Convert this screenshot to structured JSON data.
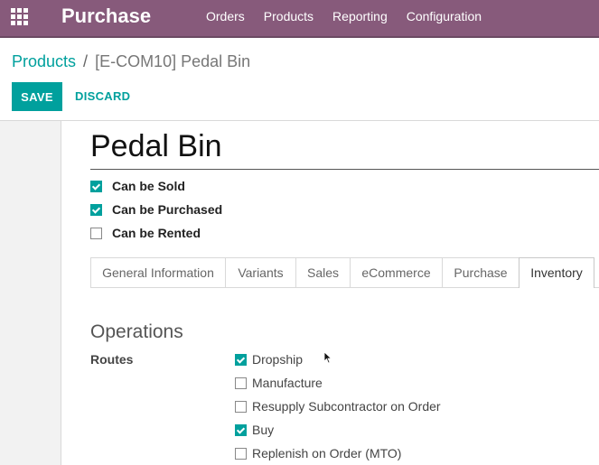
{
  "navbar": {
    "app_name": "Purchase",
    "menu": [
      "Orders",
      "Products",
      "Reporting",
      "Configuration"
    ]
  },
  "breadcrumb": {
    "parent": "Products",
    "separator": "/",
    "current": "[E-COM10] Pedal Bin"
  },
  "actions": {
    "save": "SAVE",
    "discard": "DISCARD"
  },
  "product": {
    "name": "Pedal Bin",
    "options": [
      {
        "label": "Can be Sold",
        "checked": true
      },
      {
        "label": "Can be Purchased",
        "checked": true
      },
      {
        "label": "Can be Rented",
        "checked": false
      }
    ]
  },
  "tabs": [
    {
      "label": "General Information",
      "active": false
    },
    {
      "label": "Variants",
      "active": false
    },
    {
      "label": "Sales",
      "active": false
    },
    {
      "label": "eCommerce",
      "active": false
    },
    {
      "label": "Purchase",
      "active": false
    },
    {
      "label": "Inventory",
      "active": true
    }
  ],
  "operations": {
    "title": "Operations",
    "routes_label": "Routes",
    "routes": [
      {
        "label": "Dropship",
        "checked": true
      },
      {
        "label": "Manufacture",
        "checked": false
      },
      {
        "label": "Resupply Subcontractor on Order",
        "checked": false
      },
      {
        "label": "Buy",
        "checked": true
      },
      {
        "label": "Replenish on Order (MTO)",
        "checked": false
      }
    ]
  },
  "colors": {
    "navbar": "#875a7b",
    "accent": "#00a09d"
  },
  "icons": {
    "apps": "grid-icon",
    "pointer": "mouse-cursor-icon"
  }
}
